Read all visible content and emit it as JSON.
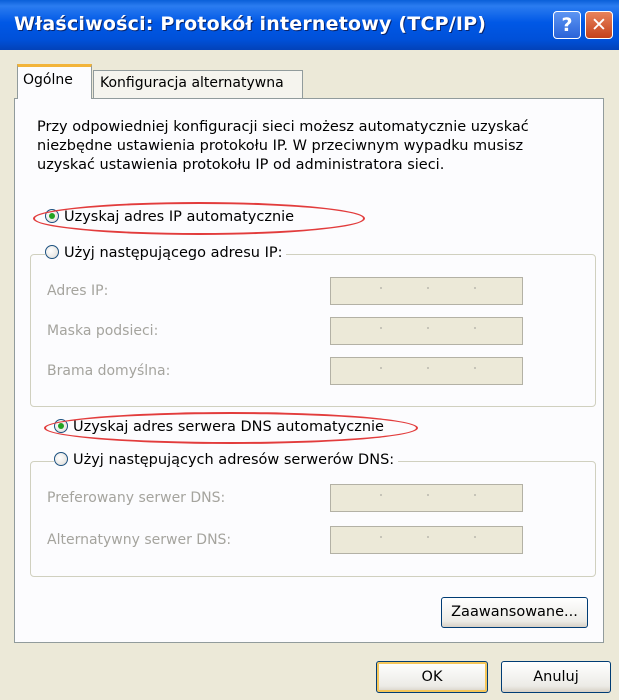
{
  "window": {
    "title": "Właściwości: Protokół internetowy (TCP/IP)",
    "help_glyph": "?",
    "close_glyph": "✕"
  },
  "tabs": [
    {
      "label": "Ogólne",
      "active": true
    },
    {
      "label": "Konfiguracja alternatywna",
      "active": false
    }
  ],
  "description": "Przy odpowiedniej konfiguracji sieci możesz automatycznie uzyskać niezbędne ustawienia protokołu IP. W przeciwnym wypadku musisz uzyskać ustawienia protokołu IP od administratora sieci.",
  "ip": {
    "auto_label": "Uzyskaj adres IP automatycznie",
    "auto_selected": true,
    "manual_label": "Użyj następującego adresu IP:",
    "fields": [
      {
        "label": "Adres IP:",
        "value": ""
      },
      {
        "label": "Maska podsieci:",
        "value": ""
      },
      {
        "label": "Brama domyślna:",
        "value": ""
      }
    ]
  },
  "dns": {
    "auto_label": "Uzyskaj adres serwera DNS automatycznie",
    "auto_selected": true,
    "manual_label": "Użyj następujących adresów serwerów DNS:",
    "fields": [
      {
        "label": "Preferowany serwer DNS:",
        "value": ""
      },
      {
        "label": "Alternatywny serwer DNS:",
        "value": ""
      }
    ]
  },
  "buttons": {
    "advanced": "Zaawansowane...",
    "ok": "OK",
    "cancel": "Anuluj"
  },
  "colors": {
    "titlebar": "#0058e6",
    "dialog_bg": "#ece9d8",
    "highlight_ellipse": "#e23c3c",
    "radio_dot": "#21a121"
  }
}
